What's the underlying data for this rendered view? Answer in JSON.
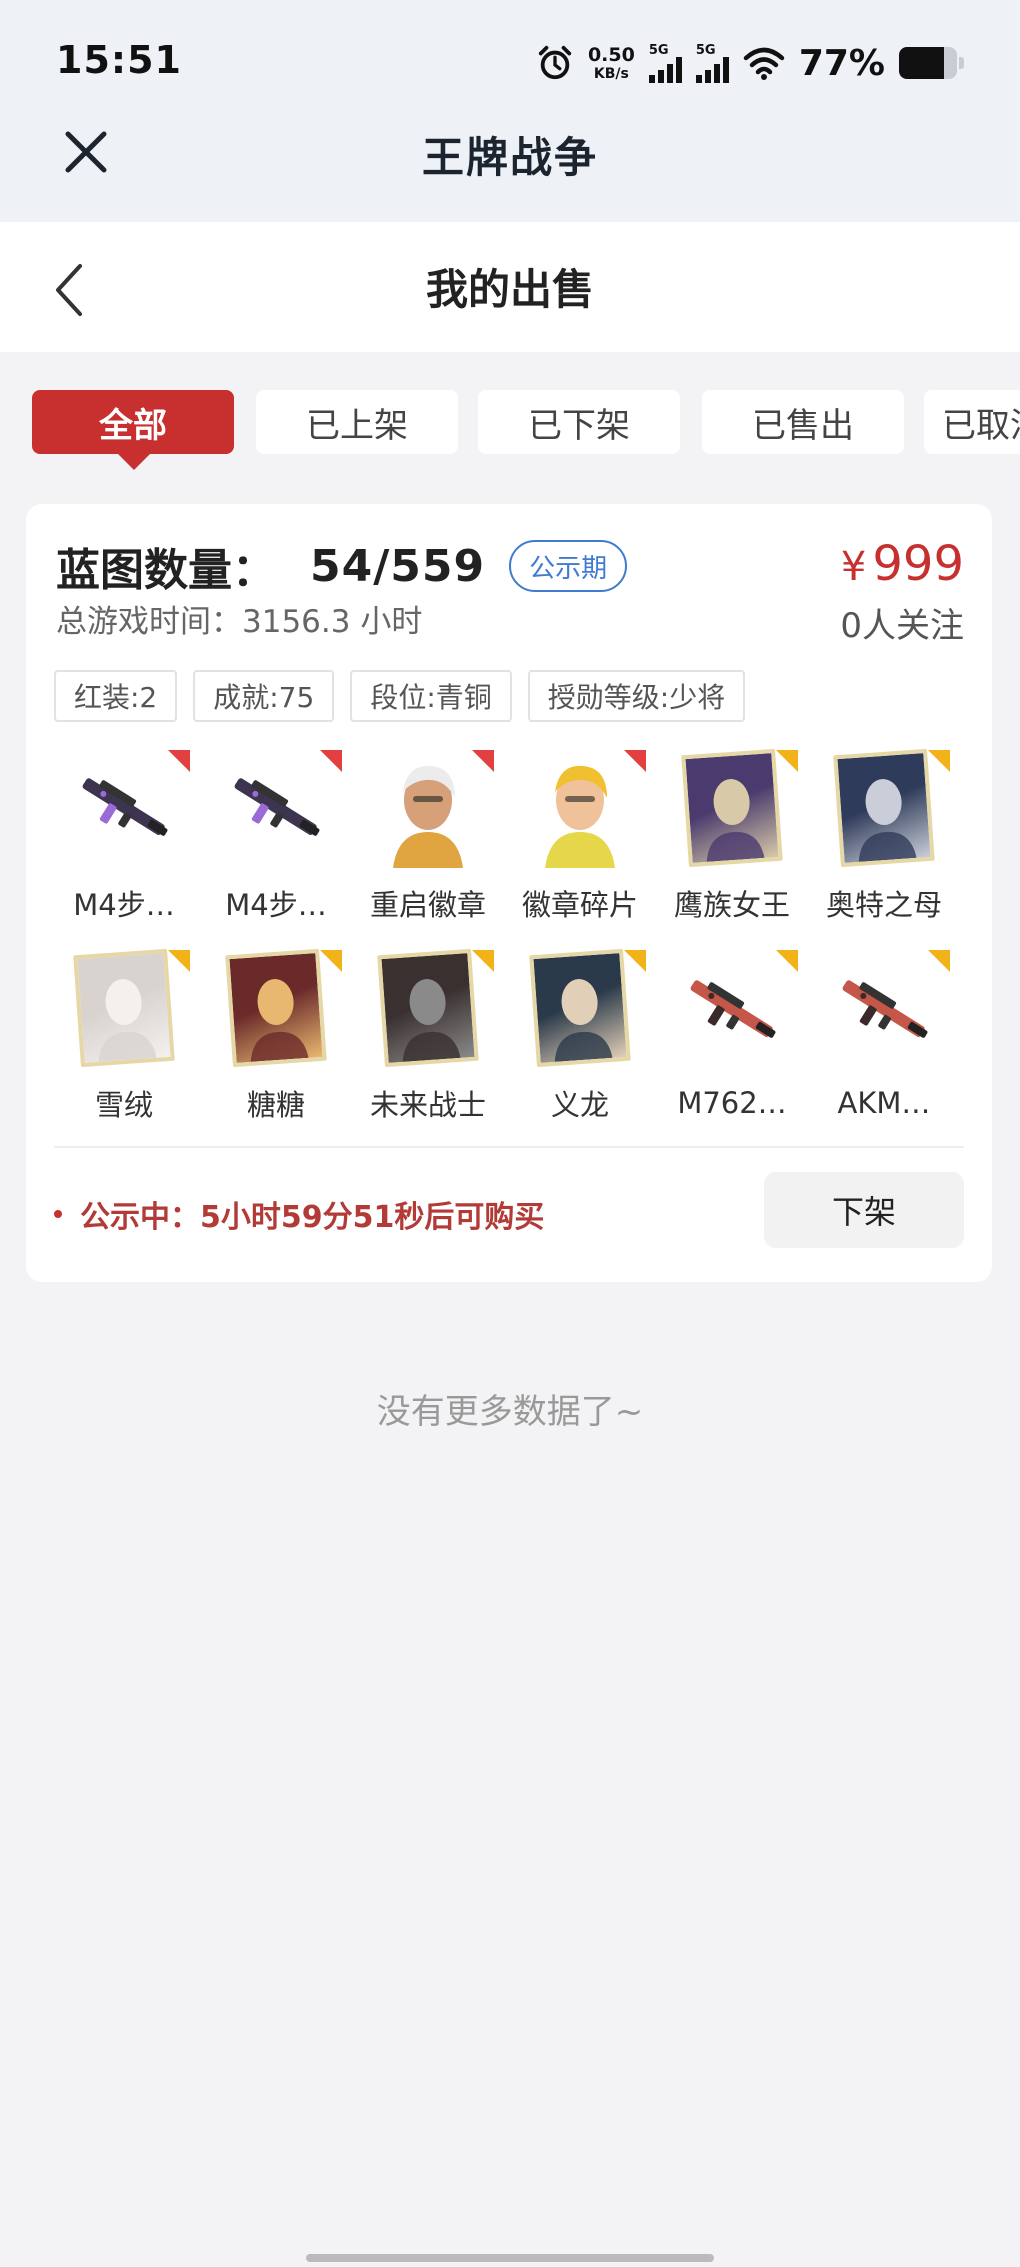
{
  "status_bar": {
    "time": "15:51",
    "net_speed_value": "0.50",
    "net_speed_unit": "KB/s",
    "signal1_tag": "5G",
    "signal2_tag": "5G",
    "battery_percent": "77%",
    "battery_level": 0.77
  },
  "app_header": {
    "title": "王牌战争"
  },
  "page_header": {
    "title": "我的出售"
  },
  "tabs": [
    {
      "label": "全部",
      "active": true
    },
    {
      "label": "已上架",
      "active": false
    },
    {
      "label": "已下架",
      "active": false
    },
    {
      "label": "已售出",
      "active": false
    },
    {
      "label": "已取消",
      "active": false
    }
  ],
  "listing": {
    "blueprint_label": "蓝图数量：",
    "blueprint_count": "54/559",
    "badge": "公示期",
    "play_time": "总游戏时间：3156.3 小时",
    "price_symbol": "¥",
    "price": "999",
    "followers": "0人关注",
    "tags": [
      "红装:2",
      "成就:75",
      "段位:青铜",
      "授勋等级:少将"
    ],
    "items": [
      {
        "name": "M4步…",
        "kind": "rifle",
        "rarity": "red"
      },
      {
        "name": "M4步…",
        "kind": "rifle",
        "rarity": "red"
      },
      {
        "name": "重启徽章",
        "kind": "character",
        "rarity": "red"
      },
      {
        "name": "徽章碎片",
        "kind": "character",
        "rarity": "red"
      },
      {
        "name": "鹰族女王",
        "kind": "portrait",
        "rarity": "gold"
      },
      {
        "name": "奥特之母",
        "kind": "portrait",
        "rarity": "gold"
      },
      {
        "name": "雪绒",
        "kind": "portrait",
        "rarity": "gold"
      },
      {
        "name": "糖糖",
        "kind": "portrait",
        "rarity": "gold"
      },
      {
        "name": "未来战士",
        "kind": "portrait",
        "rarity": "gold"
      },
      {
        "name": "义龙",
        "kind": "portrait",
        "rarity": "gold"
      },
      {
        "name": "M762…",
        "kind": "rifle",
        "rarity": "gold"
      },
      {
        "name": "AKM…",
        "kind": "rifle",
        "rarity": "gold"
      }
    ],
    "notice": "公示中：5小时59分51秒后可购买",
    "delist_button": "下架"
  },
  "footer": {
    "no_more": "没有更多数据了~"
  },
  "colors": {
    "accent_red": "#c7302f",
    "badge_blue": "#3f7bd1",
    "rare_gold": "#f2b21a",
    "rare_red": "#e04040"
  },
  "icons": {
    "close": "close-icon",
    "back": "back-arrow-icon",
    "alarm": "alarm-icon",
    "wifi": "wifi-icon"
  }
}
